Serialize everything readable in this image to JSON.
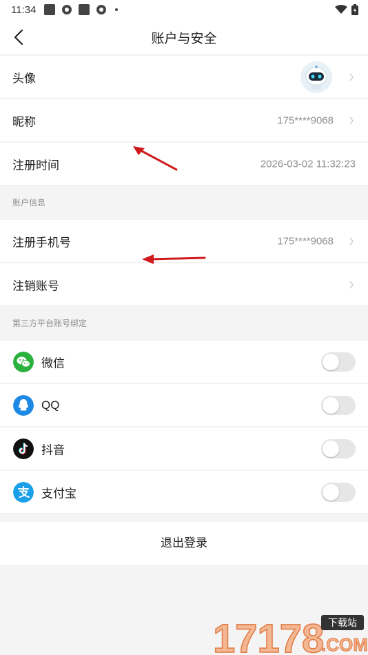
{
  "status_bar": {
    "time": "11:34",
    "icons": [
      "square-icon",
      "gear-icon",
      "square-icon",
      "gear-icon",
      "dot-icon"
    ],
    "right_icons": [
      "wifi-icon",
      "battery-icon"
    ]
  },
  "navbar": {
    "title": "账户与安全",
    "back_icon": "back-arrow-icon"
  },
  "rows": {
    "avatar": {
      "label": "头像",
      "icon": "robot-avatar"
    },
    "nickname": {
      "label": "昵称",
      "value": "175****9068"
    },
    "register_time": {
      "label": "注册时间",
      "value": "2026-03-02 11:32:23"
    }
  },
  "account_info": {
    "title": "账户信息",
    "phone": {
      "label": "注册手机号",
      "value": "175****9068"
    },
    "cancel": {
      "label": "注销账号"
    }
  },
  "third_party": {
    "title": "第三方平台账号绑定",
    "items": [
      {
        "label": "微信",
        "icon": "wechat-icon",
        "color": "#2ab13e",
        "enabled": false
      },
      {
        "label": "QQ",
        "icon": "qq-icon",
        "color": "#1e88e5",
        "enabled": false
      },
      {
        "label": "抖音",
        "icon": "douyin-icon",
        "color": "#111111",
        "enabled": false
      },
      {
        "label": "支付宝",
        "icon": "alipay-icon",
        "color": "#1aa0e8",
        "enabled": false
      }
    ]
  },
  "logout": {
    "label": "退出登录"
  },
  "watermark": {
    "text": "17178",
    "badge": "下载站",
    "domain": ".COM"
  },
  "colors": {
    "accent_red": "#d0191c",
    "background": "#f4f4f4",
    "secondary_text": "#8e8e8e"
  }
}
